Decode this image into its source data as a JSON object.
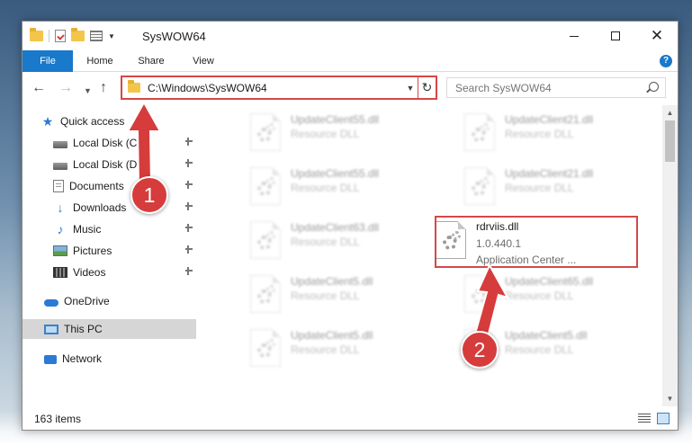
{
  "window": {
    "title": "SysWOW64"
  },
  "ribbon": {
    "tabs": [
      "File",
      "Home",
      "Share",
      "View"
    ],
    "help": "?"
  },
  "navigation": {
    "address": "C:\\Windows\\SysWOW64",
    "search_placeholder": "Search SysWOW64"
  },
  "sidebar": {
    "items": [
      {
        "label": "Quick access",
        "icon": "star-icon",
        "pinned": false
      },
      {
        "label": "Local Disk (C:)",
        "icon": "disk-icon",
        "pinned": true
      },
      {
        "label": "Local Disk (D:)",
        "icon": "disk-icon",
        "pinned": true
      },
      {
        "label": "Documents",
        "icon": "document-icon",
        "pinned": true
      },
      {
        "label": "Downloads",
        "icon": "download-icon",
        "pinned": true
      },
      {
        "label": "Music",
        "icon": "music-icon",
        "pinned": true
      },
      {
        "label": "Pictures",
        "icon": "pictures-icon",
        "pinned": true
      },
      {
        "label": "Videos",
        "icon": "videos-icon",
        "pinned": true
      },
      {
        "label": "OneDrive",
        "icon": "cloud-icon",
        "pinned": false
      },
      {
        "label": "This PC",
        "icon": "computer-icon",
        "pinned": false,
        "selected": true
      },
      {
        "label": "Network",
        "icon": "network-icon",
        "pinned": false
      }
    ]
  },
  "files": [
    {
      "name": "UpdateClient55.dll",
      "type": "Resource DLL"
    },
    {
      "name": "UpdateClient21.dll",
      "type": "Resource DLL"
    },
    {
      "name": "UpdateClient55.dll",
      "type": "Resource DLL"
    },
    {
      "name": "UpdateClient21.dll",
      "type": "Resource DLL"
    },
    {
      "name": "UpdateClient63.dll",
      "type": "Resource DLL"
    },
    {
      "name": "rdrviis.dll",
      "version": "1.0.440.1",
      "type": "Application Center ...",
      "highlighted": true
    },
    {
      "name": "UpdateClient5.dll",
      "type": "Resource DLL"
    },
    {
      "name": "UpdateClient65.dll",
      "type": "Resource DLL"
    },
    {
      "name": "UpdateClient5.dll",
      "type": "Resource DLL"
    },
    {
      "name": "UpdateClient5.dll",
      "type": "Resource DLL"
    }
  ],
  "status": {
    "item_count": "163 items"
  },
  "annotations": {
    "step1": "1",
    "step2": "2",
    "color": "#d63c3c"
  },
  "colors": {
    "accent": "#1979ca",
    "highlight": "#d44848"
  }
}
